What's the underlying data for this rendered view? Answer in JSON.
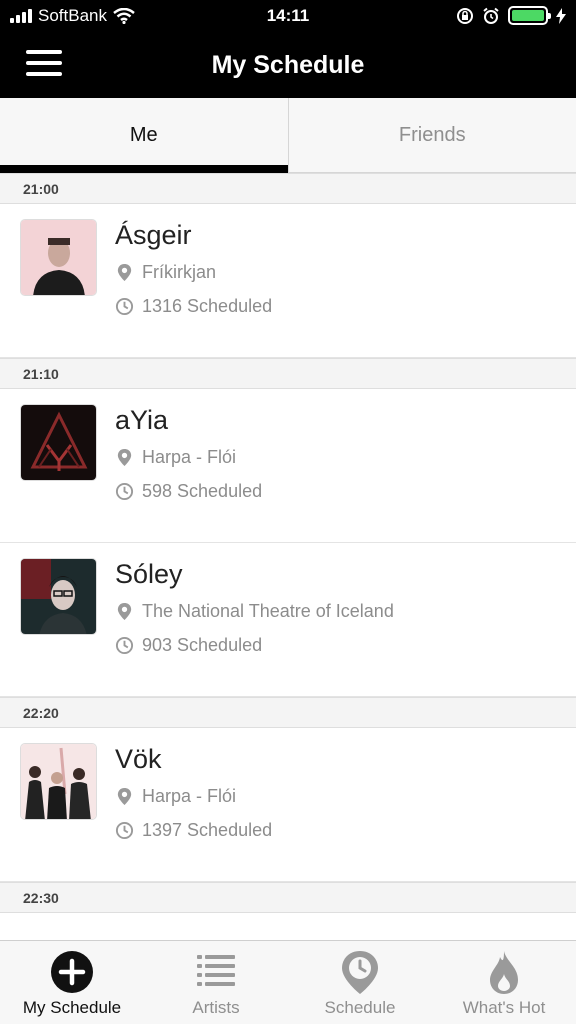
{
  "status_bar": {
    "carrier": "SoftBank",
    "time": "14:11",
    "battery_color": "#4cd964"
  },
  "nav": {
    "title": "My Schedule",
    "menu_icon": "hamburger-menu-icon"
  },
  "tabs": [
    {
      "label": "Me",
      "active": true
    },
    {
      "label": "Friends",
      "active": false
    }
  ],
  "schedule": {
    "sections": [
      {
        "time": "21:00",
        "items": [
          {
            "name": "Ásgeir",
            "venue": "Fríkirkjan",
            "scheduled": "1316 Scheduled"
          }
        ]
      },
      {
        "time": "21:10",
        "items": [
          {
            "name": "aYia",
            "venue": "Harpa - Flói",
            "scheduled": "598 Scheduled"
          },
          {
            "name": "Sóley",
            "venue": "The National Theatre of Iceland",
            "scheduled": "903 Scheduled"
          }
        ]
      },
      {
        "time": "22:20",
        "items": [
          {
            "name": "Vök",
            "venue": "Harpa - Flói",
            "scheduled": "1397 Scheduled"
          }
        ]
      },
      {
        "time": "22:30",
        "items": []
      }
    ]
  },
  "tab_bar": {
    "items": [
      {
        "label": "My Schedule",
        "icon": "plus-circle-icon",
        "active": true
      },
      {
        "label": "Artists",
        "icon": "list-icon",
        "active": false
      },
      {
        "label": "Schedule",
        "icon": "clock-pin-icon",
        "active": false
      },
      {
        "label": "What's Hot",
        "icon": "flame-icon",
        "active": false
      }
    ]
  },
  "colors": {
    "header_bg": "#000000",
    "muted_text": "#8c8c8c",
    "active_indicator": "#000000"
  }
}
